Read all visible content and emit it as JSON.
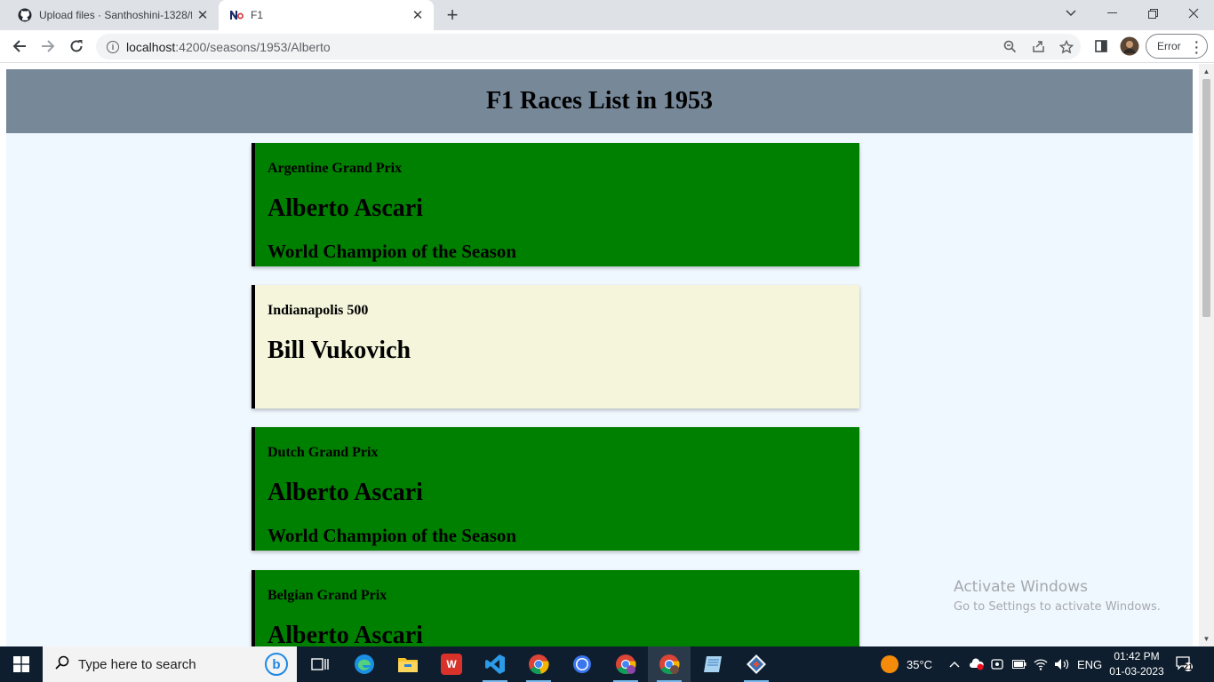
{
  "browser": {
    "tabs": [
      {
        "title": "Upload files · Santhoshini-1328/f",
        "favicon": "github-icon",
        "active": false
      },
      {
        "title": "F1",
        "favicon": "nest-icon",
        "active": true
      }
    ],
    "url_host": "localhost",
    "url_rest": ":4200/seasons/1953/Alberto",
    "error_label": "Error"
  },
  "page": {
    "title": "F1 Races List in 1953",
    "races": [
      {
        "race": "Argentine Grand Prix",
        "driver": "Alberto Ascari",
        "champion_label": "World Champion of the Season",
        "is_champion": true
      },
      {
        "race": "Indianapolis 500",
        "driver": "Bill Vukovich",
        "champion_label": "",
        "is_champion": false
      },
      {
        "race": "Dutch Grand Prix",
        "driver": "Alberto Ascari",
        "champion_label": "World Champion of the Season",
        "is_champion": true
      },
      {
        "race": "Belgian Grand Prix",
        "driver": "Alberto Ascari",
        "champion_label": "",
        "is_champion": true
      }
    ],
    "colors": {
      "header": "#778899",
      "background": "#f0f8ff",
      "champion_card": "#008000",
      "other_card": "#f5f5dc"
    }
  },
  "watermark": {
    "line1": "Activate Windows",
    "line2": "Go to Settings to activate Windows."
  },
  "taskbar": {
    "search_placeholder": "Type here to search",
    "temperature": "35°C",
    "language": "ENG",
    "time": "01:42 PM",
    "date": "01-03-2023",
    "notification_count": "21"
  }
}
